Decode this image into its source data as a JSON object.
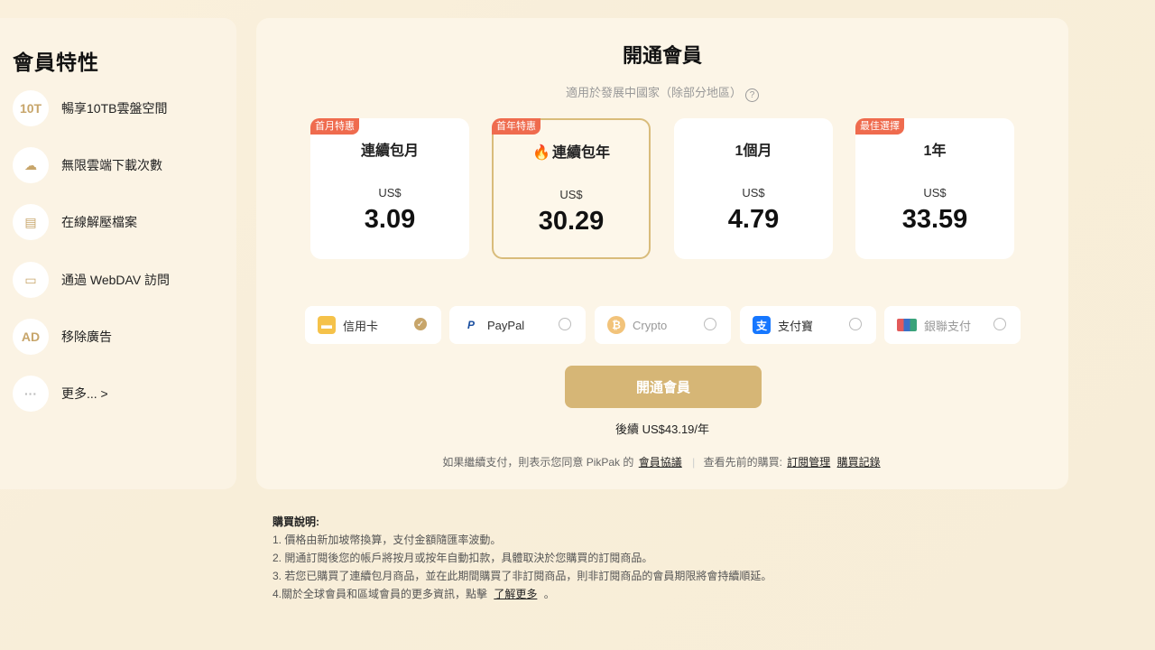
{
  "sidebar": {
    "title": "會員特性",
    "items": [
      {
        "icon_text": "10T",
        "icon": "storage-10t-icon",
        "label": "暢享10TB雲盤空間"
      },
      {
        "icon_text": "☁",
        "icon": "cloud-download-icon",
        "label": "無限雲端下載次數"
      },
      {
        "icon_text": "▤",
        "icon": "archive-zip-icon",
        "label": "在線解壓檔案"
      },
      {
        "icon_text": "▭",
        "icon": "webdav-drive-icon",
        "label": "通過 WebDAV 訪問"
      },
      {
        "icon_text": "AD",
        "icon": "ad-remove-icon",
        "label": "移除廣告"
      },
      {
        "icon_text": "···",
        "icon": "more-dots-icon",
        "label": "更多... >"
      }
    ]
  },
  "main": {
    "title": "開通會員",
    "subtitle": "適用於發展中國家（除部分地區）",
    "plans": [
      {
        "badge": "首月特惠",
        "name": "連續包月",
        "currency": "US$",
        "price": "3.09"
      },
      {
        "badge": "首年特惠",
        "name": "連續包年",
        "currency": "US$",
        "price": "30.29"
      },
      {
        "badge": "",
        "name": "1個月",
        "currency": "US$",
        "price": "4.79"
      },
      {
        "badge": "最佳選擇",
        "name": "1年",
        "currency": "US$",
        "price": "33.59"
      }
    ],
    "payments": [
      {
        "label": "信用卡",
        "icon": "credit-card-icon"
      },
      {
        "label": "PayPal",
        "icon": "paypal-icon"
      },
      {
        "label": "Crypto",
        "icon": "crypto-icon"
      },
      {
        "label": "支付寶",
        "icon": "alipay-icon"
      },
      {
        "label": "銀聯支付",
        "icon": "unionpay-icon"
      }
    ],
    "cta": "開通會員",
    "renewal": "後續 US$43.19/年",
    "agreement_text": "如果繼續支付，則表示您同意 PikPak 的",
    "agreement_link": "會員協議",
    "history_text": "查看先前的購買:",
    "manage_link": "訂閱管理",
    "records_link": "購買記錄"
  },
  "notes": {
    "heading": "購買說明:",
    "lines": [
      "1. 價格由新加坡幣換算，支付金額隨匯率波動。",
      "2. 開通訂閱後您的帳戶將按月或按年自動扣款，具體取決於您購買的訂閱商品。",
      "3. 若您已購買了連續包月商品，並在此期間購買了非訂閱商品，則非訂閱商品的會員期限將會持續順延。",
      "4.關於全球會員和區域會員的更多資訊，點擊"
    ],
    "learn_more": "了解更多",
    "tail": "。"
  },
  "colors": {
    "accent": "#d6b676",
    "badge": "#ef6b4e",
    "gold": "#c7a56a"
  }
}
